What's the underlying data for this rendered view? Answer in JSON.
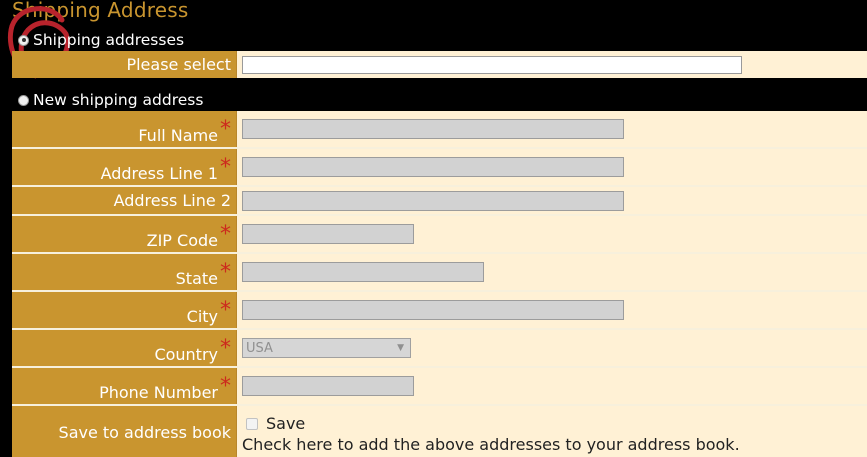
{
  "section_title": "Shipping Address",
  "options": {
    "existing_label": "Shipping addresses",
    "new_label": "New shipping address"
  },
  "select_prompt_label": "Please select",
  "fields": {
    "full_name": "Full Name",
    "address1": "Address Line 1",
    "address2": "Address Line 2",
    "zip": "ZIP Code",
    "state": "State",
    "city": "City",
    "country": "Country",
    "country_value": "USA",
    "phone": "Phone Number"
  },
  "required_mark": "*",
  "save": {
    "label": "Save to address book",
    "checkbox_label": "Save",
    "help": "Check here to add the above addresses to your address book."
  },
  "colors": {
    "label_bg": "#c9952f",
    "value_bg": "#fff1d5",
    "required": "#cc2a1e",
    "title": "#c9952f"
  }
}
